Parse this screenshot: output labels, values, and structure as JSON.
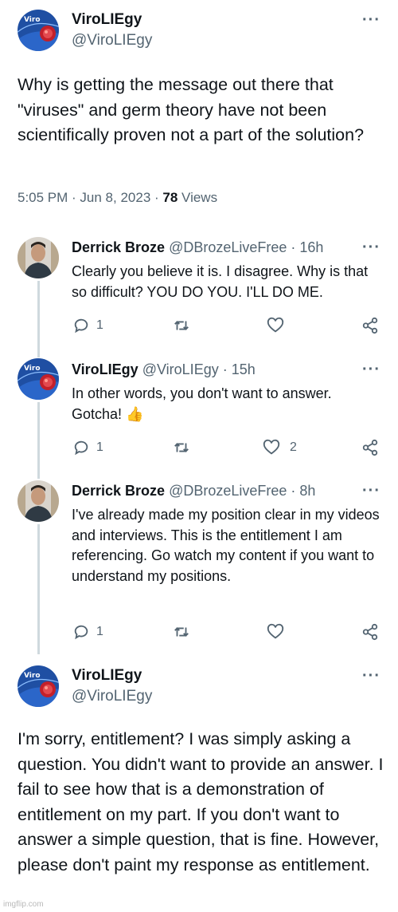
{
  "main_tweet": {
    "name": "ViroLIEgy",
    "handle": "@ViroLIEgy",
    "text": "Why is getting the message out there that \"viruses\" and germ theory have not been scientifically proven not a part of the solution?",
    "time": "5:05 PM · Jun 8, 2023 · ",
    "views_count": "78",
    "views_label": " Views",
    "more_icon": "more-dots-icon"
  },
  "replies": [
    {
      "name": "Derrick Broze",
      "handle": "@DBrozeLiveFree · 16h",
      "text": "Clearly you believe it is. I disagree. Why is that so difficult? YOU DO YOU. I'LL DO ME.",
      "reply_count": "1",
      "retweet_count": "",
      "like_count": ""
    },
    {
      "name": "ViroLIEgy",
      "handle": "@ViroLIEgy · 15h",
      "text": "In other words, you don't want to answer. Gotcha! 👍",
      "reply_count": "1",
      "retweet_count": "",
      "like_count": "2"
    },
    {
      "name": "Derrick Broze",
      "handle": "@DBrozeLiveFree · 8h",
      "text": "I've already made my position clear in my videos and interviews. This is the entitlement I am referencing. Go watch my content if you want to understand my positions.",
      "reply_count": "1",
      "retweet_count": "",
      "like_count": ""
    }
  ],
  "final_tweet": {
    "name": "ViroLIEgy",
    "handle": "@ViroLIEgy",
    "text": "I'm sorry, entitlement? I was simply asking a question. You didn't want to provide an answer. I fail to see how that is a demonstration of entitlement on my part. If you don't want to answer a simple question, that is fine. However, please don't paint my response as entitlement."
  },
  "more_glyph": "···",
  "watermark": "imgflip.com",
  "colors": {
    "text": "#0f1419",
    "secondary": "#536471",
    "thread_line": "#cfd9de"
  }
}
